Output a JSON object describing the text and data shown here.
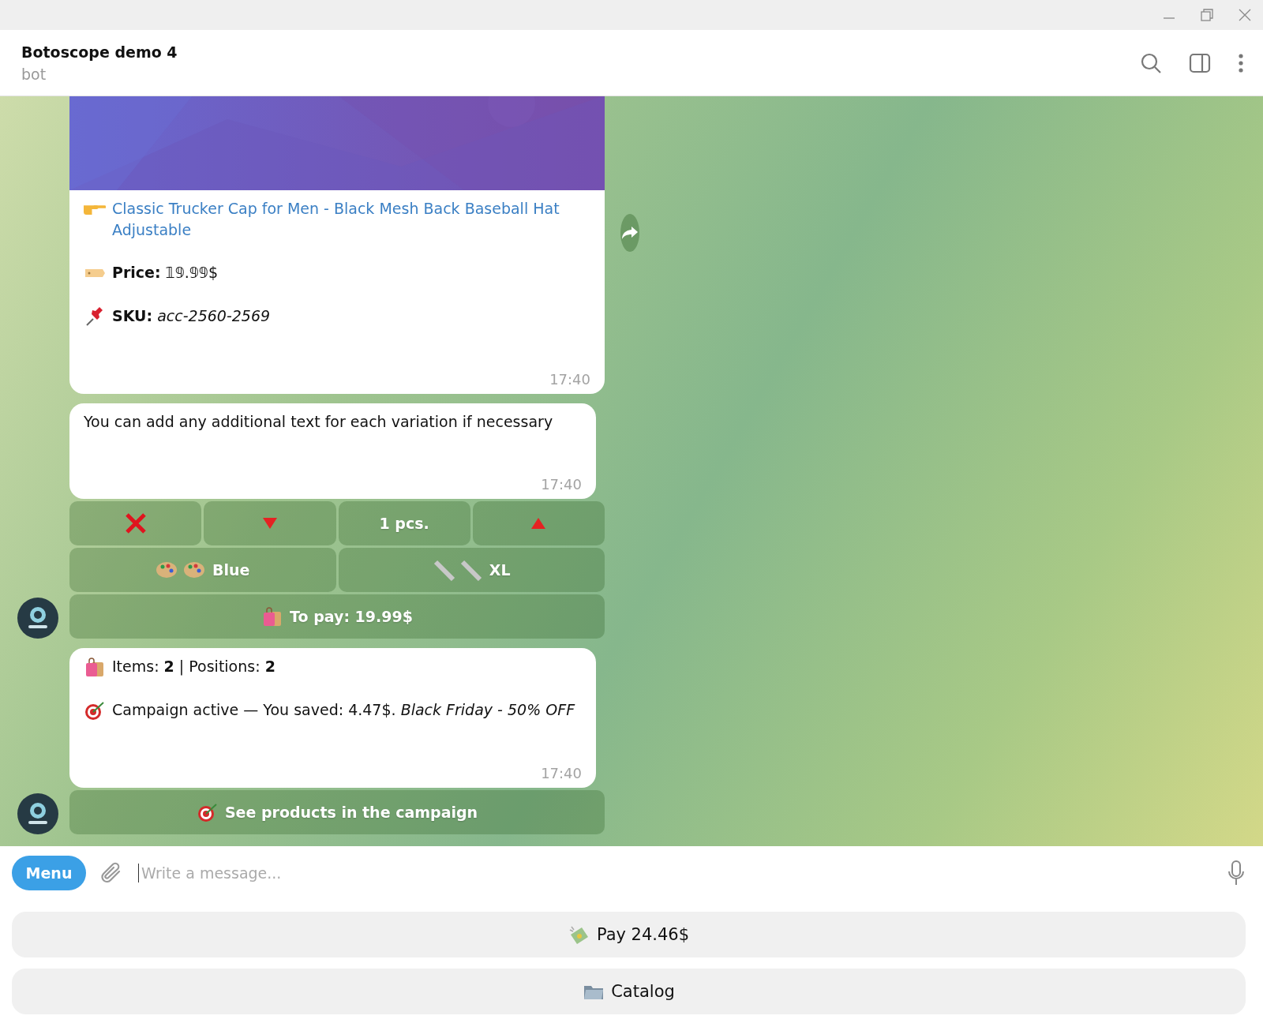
{
  "header": {
    "title": "Botoscope demo 4",
    "subtitle": "bot"
  },
  "messages": [
    {
      "photo": {
        "kind": "picture"
      },
      "forward": true,
      "lines": [
        {
          "kind": "link",
          "text": "Classic Trucker Cap for Men - Black Mesh Back Baseball Hat Adjustable"
        },
        {
          "kind": "price",
          "text": "**Price:** 𝟙𝟡.𝟡𝟡$"
        },
        {
          "kind": "sku",
          "text": "**SKU:** *acc-2560-2569*"
        }
      ],
      "time": "17:40"
    },
    {
      "lines": [
        {
          "kind": "plain",
          "text": "You can add any additional text for each variation if necessary"
        }
      ],
      "time": "17:40",
      "keyboard": [
        [
          {
            "kind": "remove"
          },
          {
            "kind": "decrease"
          },
          {
            "kind": "quantity",
            "label": "1 pcs."
          },
          {
            "kind": "increase"
          }
        ],
        [
          {
            "kind": "color",
            "label": "Blue"
          },
          {
            "kind": "size",
            "label": "XL"
          }
        ],
        [
          {
            "kind": "total",
            "label": "To pay: 19.99$"
          }
        ]
      ],
      "avatar": true
    },
    {
      "lines": [
        {
          "kind": "items",
          "text": "Items: **2** | Positions: **2**"
        },
        {
          "kind": "campaign",
          "text": "Campaign active — You saved: 4.47$. *Black Friday - 50% OFF*"
        }
      ],
      "time": "17:40",
      "keyboard": [
        [
          {
            "kind": "campaign",
            "label": "See products in the campaign"
          }
        ]
      ],
      "avatar": true
    }
  ],
  "composer": {
    "menu": "Menu",
    "placeholder": "Write a message..."
  },
  "reply_keyboard": [
    {
      "kind": "pay",
      "label": "Pay 24.46$"
    },
    {
      "kind": "catalog",
      "label": "Catalog"
    }
  ]
}
